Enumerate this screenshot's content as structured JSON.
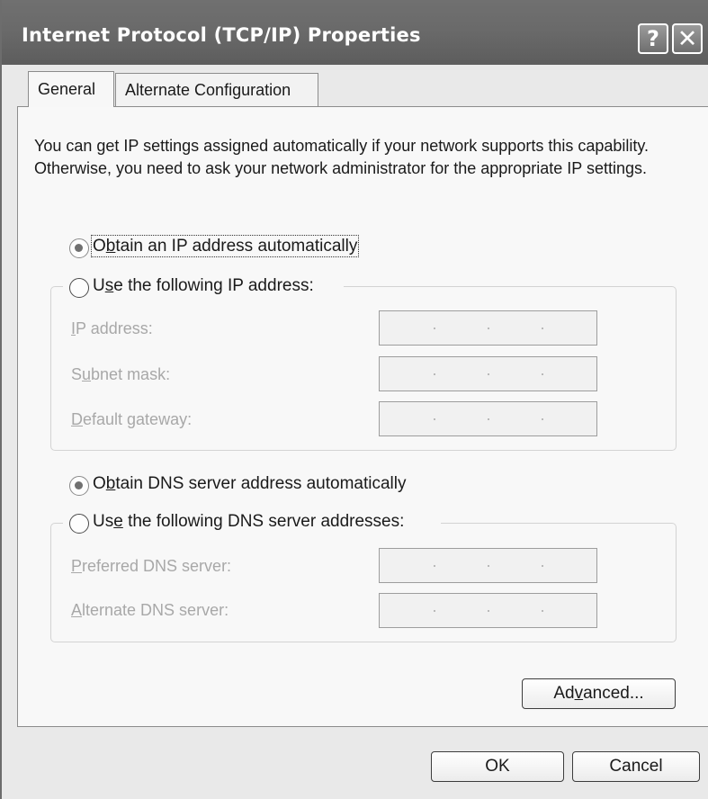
{
  "window": {
    "title": "Internet Protocol (TCP/IP) Properties",
    "help_glyph": "?",
    "close_glyph": "✕"
  },
  "tabs": [
    {
      "label": "General",
      "active": true
    },
    {
      "label": "Alternate Configuration",
      "active": false
    }
  ],
  "intro_text": "You can get IP settings assigned automatically if your network supports this capability. Otherwise, you need to ask your network administrator for the appropriate IP settings.",
  "ip_mode": {
    "auto": {
      "pre": "O",
      "key": "b",
      "post": "tain an IP address automatically",
      "checked": true
    },
    "manual": {
      "pre": "U",
      "key": "s",
      "post": "e the following IP address:",
      "checked": false
    }
  },
  "ip_fields": [
    {
      "pre": "",
      "key": "I",
      "post": "P address:"
    },
    {
      "pre": "S",
      "key": "u",
      "post": "bnet mask:"
    },
    {
      "pre": "",
      "key": "D",
      "post": "efault gateway:"
    }
  ],
  "dns_mode": {
    "auto": {
      "pre": "O",
      "key": "b",
      "post": "tain DNS server address automatically",
      "checked": true
    },
    "manual": {
      "pre": "Us",
      "key": "e",
      "post": " the following DNS server addresses:",
      "checked": false
    }
  },
  "dns_fields": [
    {
      "pre": "",
      "key": "P",
      "post": "referred DNS server:"
    },
    {
      "pre": "",
      "key": "A",
      "post": "lternate DNS server:"
    }
  ],
  "buttons": {
    "advanced": {
      "pre": "Ad",
      "key": "v",
      "post": "anced..."
    },
    "ok": "OK",
    "cancel": "Cancel"
  }
}
